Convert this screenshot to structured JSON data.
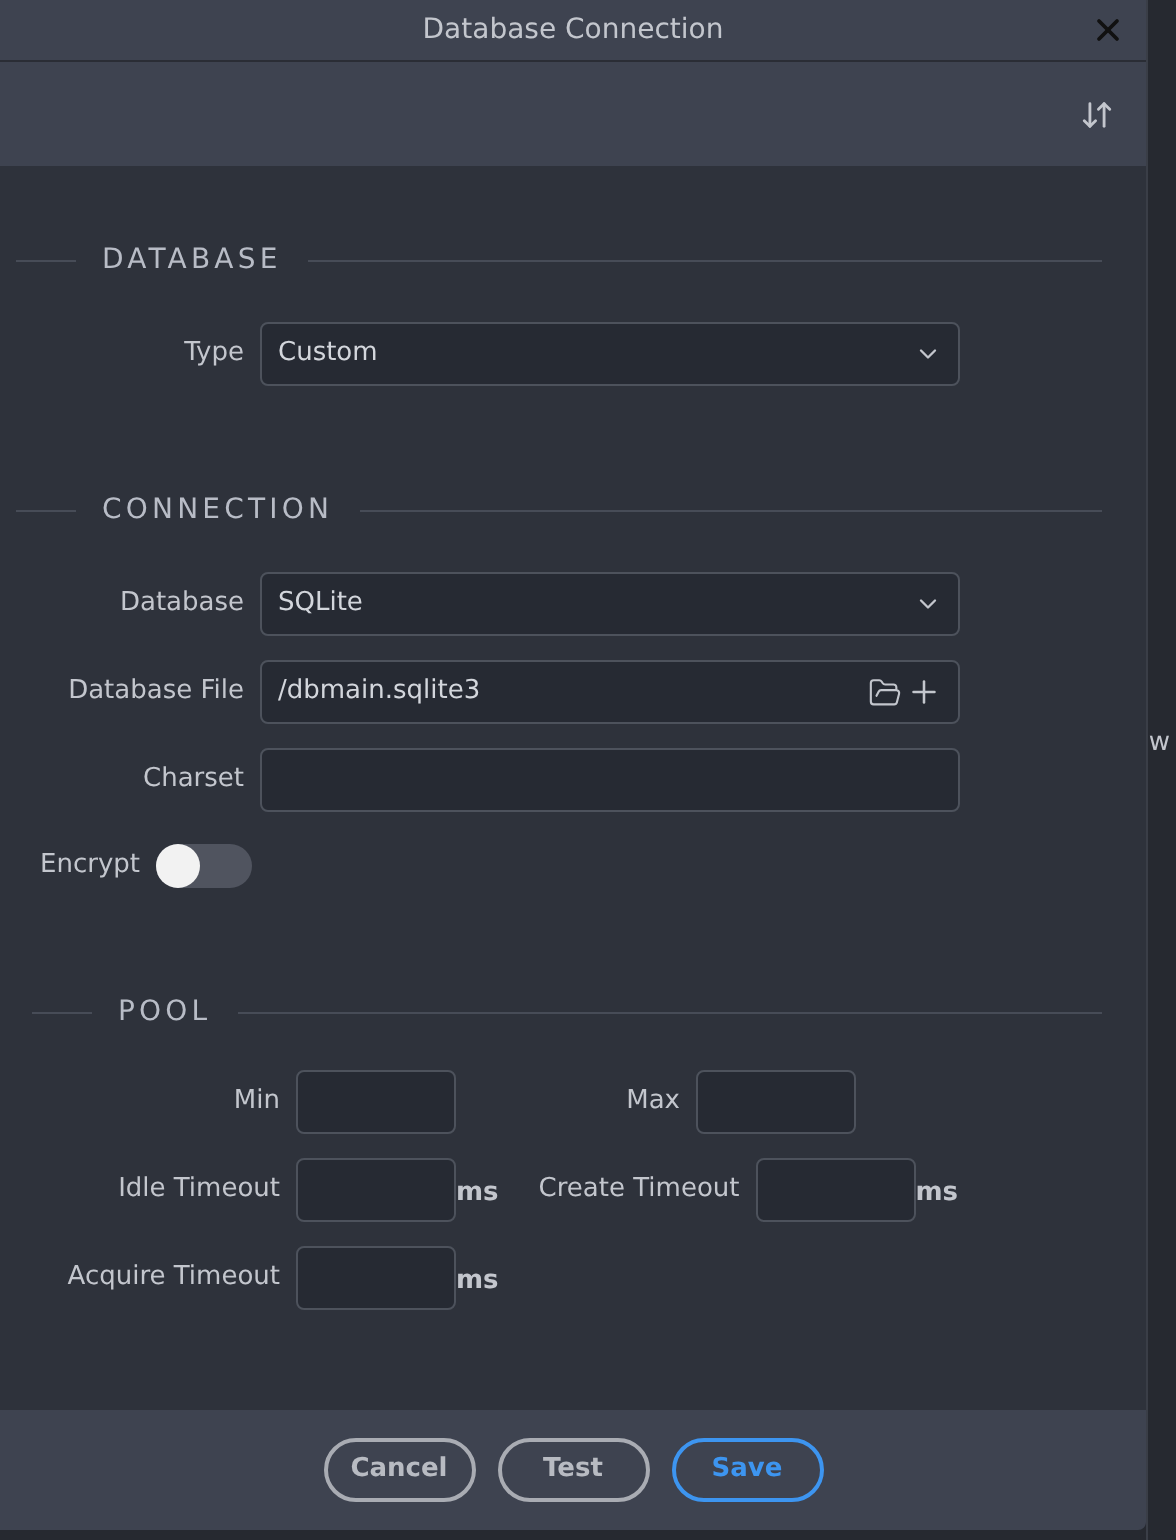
{
  "window": {
    "title": "Database Connection"
  },
  "sections": [
    {
      "title": "DATABASE",
      "fields": [
        {
          "kind": "select",
          "label": "Type",
          "value": "Custom"
        }
      ]
    },
    {
      "title": "CONNECTION",
      "fields": [
        {
          "kind": "select",
          "label": "Database",
          "value": "SQLite"
        },
        {
          "kind": "file",
          "label": "Database File",
          "value": "/dbmain.sqlite3"
        },
        {
          "kind": "text",
          "label": "Charset"
        },
        {
          "kind": "toggle",
          "label": "Encrypt",
          "on": false
        }
      ]
    }
  ],
  "pool": {
    "title": "POOL",
    "rows": [
      [
        {
          "label": "Min"
        },
        {
          "label": "Max"
        }
      ],
      [
        {
          "label": "Idle Timeout",
          "unit": "ms"
        },
        {
          "label": "Create Timeout",
          "unit": "ms"
        }
      ],
      [
        {
          "label": "Acquire Timeout",
          "unit": "ms"
        }
      ]
    ]
  },
  "buttons": [
    {
      "label": "Cancel",
      "kind": "plain"
    },
    {
      "label": "Test",
      "kind": "plain"
    },
    {
      "label": "Save",
      "kind": "primary"
    }
  ],
  "background": {
    "text_fragment": "w"
  }
}
